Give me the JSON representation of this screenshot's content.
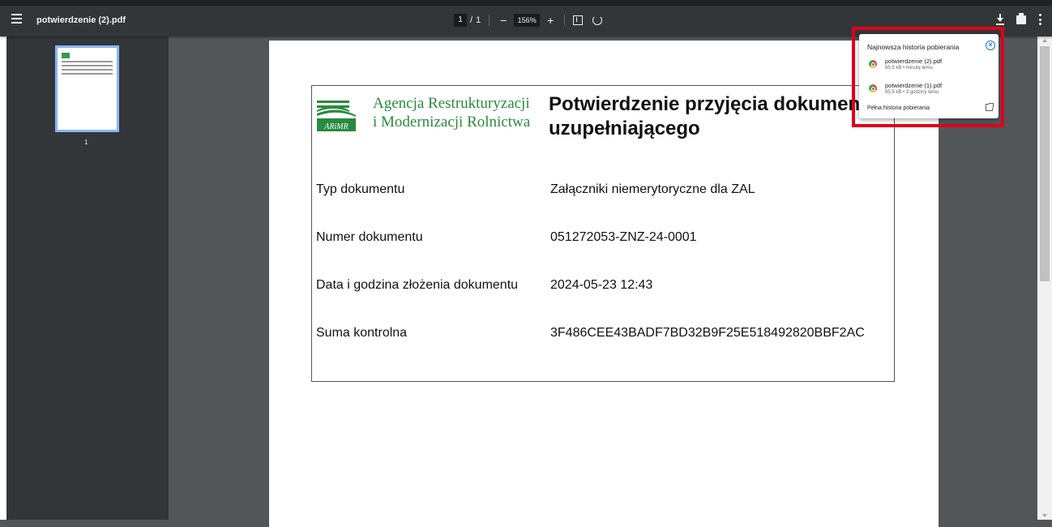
{
  "toolbar": {
    "title": "potwierdzenie (2).pdf",
    "page_current": "1",
    "page_separator": "/",
    "page_total": "1",
    "zoom": "156%",
    "zoom_out_label": "−",
    "zoom_in_label": "+"
  },
  "sidebar": {
    "thumbnail_page_number": "1"
  },
  "document": {
    "agency_line1": "Agencja Restrukturyzacji",
    "agency_line2": "i Modernizacji Rolnictwa",
    "logo_text": "ARiMR",
    "heading_line1": "Potwierdzenie przyjęcia dokumentu",
    "heading_line2": "uzupełniającego",
    "rows": [
      {
        "label": "Typ dokumentu",
        "value": "Załączniki niemerytoryczne dla ZAL"
      },
      {
        "label": "Numer dokumentu",
        "value": "051272053-ZNZ-24-0001"
      },
      {
        "label": "Data i godzina złożenia dokumentu",
        "value": "2024-05-23 12:43"
      },
      {
        "label": "Suma kontrolna",
        "value": "3F486CEE43BADF7BD32B9F25E518492820BBF2AC"
      }
    ]
  },
  "downloads_popup": {
    "title": "Najnowsza historia pobierania",
    "close_glyph": "×",
    "items": [
      {
        "name": "potwierdzenie (2).pdf",
        "meta": "65,5 kB • minutę temu"
      },
      {
        "name": "potwierdzenie (1).pdf",
        "meta": "65,9 kB • 3 godziny temu"
      }
    ],
    "full_history_label": "Pełna historia pobierania"
  },
  "colors": {
    "toolbar_bg": "#323639",
    "viewer_bg": "#525659",
    "agency_green": "#2a8a3e",
    "highlight_red": "#e0001a",
    "link_blue": "#1a73e8"
  }
}
